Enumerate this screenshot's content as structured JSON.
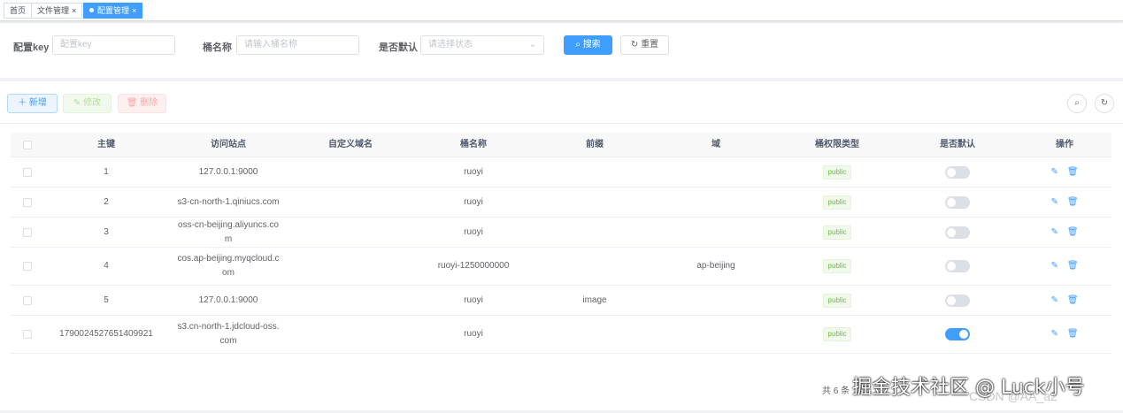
{
  "tabs": [
    {
      "label": "首页"
    },
    {
      "label": "文件管理",
      "close": "×"
    },
    {
      "label": "配置管理",
      "close": "×"
    }
  ],
  "search": {
    "key_label": "配置key",
    "key_placeholder": "配置key",
    "bucket_label": "桶名称",
    "bucket_placeholder": "请输入桶名称",
    "default_label": "是否默认",
    "default_placeholder": "请选择状态",
    "search_button": "搜索",
    "reset_button": "重置"
  },
  "toolbar": {
    "add": "新增",
    "edit": "修改",
    "delete": "删除"
  },
  "table": {
    "headers": [
      "主键",
      "访问站点",
      "自定义域名",
      "桶名称",
      "前缀",
      "域",
      "桶权限类型",
      "是否默认",
      "操作"
    ],
    "rows": [
      {
        "id": "1",
        "endpoint": "127.0.0.1:9000",
        "domain": "",
        "bucket": "ruoyi",
        "prefix": "",
        "region": "",
        "access": "public",
        "is_default": false
      },
      {
        "id": "2",
        "endpoint": "s3-cn-north-1.qiniucs.com",
        "domain": "",
        "bucket": "ruoyi",
        "prefix": "",
        "region": "",
        "access": "public",
        "is_default": false
      },
      {
        "id": "3",
        "endpoint": "oss-cn-beijing.aliyuncs.com",
        "domain": "",
        "bucket": "ruoyi",
        "prefix": "",
        "region": "",
        "access": "public",
        "is_default": false
      },
      {
        "id": "4",
        "endpoint": "cos.ap-beijing.myqcloud.com",
        "domain": "",
        "bucket": "ruoyi-1250000000",
        "prefix": "",
        "region": "ap-beijing",
        "access": "public",
        "is_default": false
      },
      {
        "id": "5",
        "endpoint": "127.0.0.1:9000",
        "domain": "",
        "bucket": "ruoyi",
        "prefix": "image",
        "region": "",
        "access": "public",
        "is_default": false
      },
      {
        "id": "1790024527651409921",
        "endpoint": "s3.cn-north-1.jdcloud-oss.com",
        "domain": "",
        "bucket": "ruoyi",
        "prefix": "",
        "region": "",
        "access": "public",
        "is_default": true
      }
    ]
  },
  "pagination": {
    "total_text": "共 6 条"
  },
  "watermark": {
    "text": "掘金技术社区 @ Luck小号",
    "sub": "CSDN @AA_a2"
  },
  "colors": {
    "primary": "#409eff",
    "success": "#67c23a",
    "danger": "#f56c6c"
  }
}
